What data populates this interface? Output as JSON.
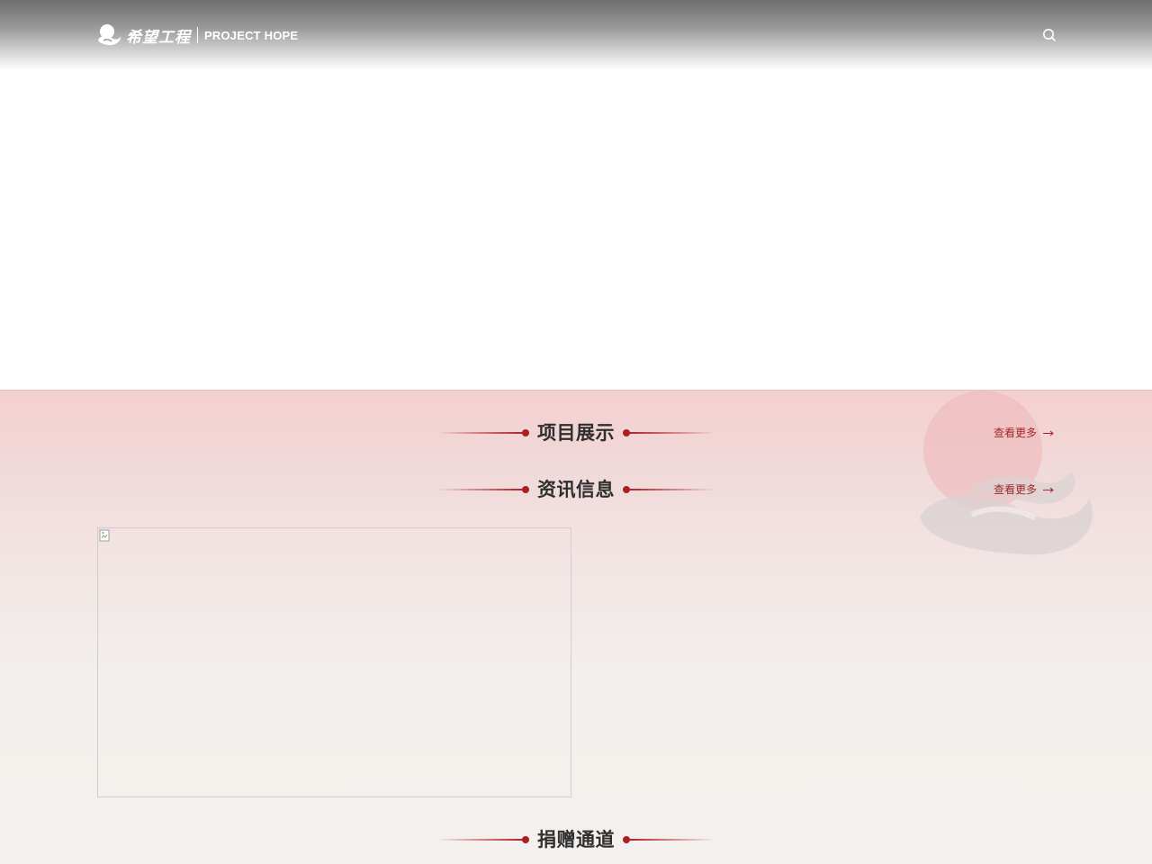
{
  "header": {
    "logo_cn": "希望工程",
    "logo_en": "PROJECT HOPE",
    "search_icon": "search-icon"
  },
  "sections": [
    {
      "title": "项目展示",
      "more_label": "查看更多"
    },
    {
      "title": "资讯信息",
      "more_label": "查看更多"
    },
    {
      "title": "捐赠通道"
    }
  ],
  "colors": {
    "accent": "#a3262b",
    "title": "#2f2f2f",
    "bg_pink": "#f4cfd0",
    "bg_light": "#f4f0ed"
  }
}
